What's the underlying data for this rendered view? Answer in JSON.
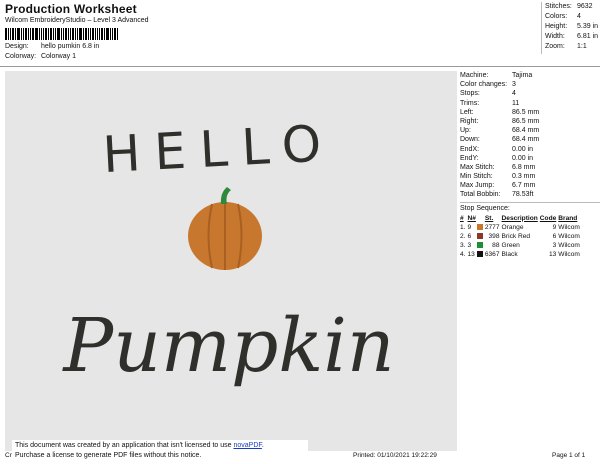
{
  "header": {
    "title": "Production Worksheet",
    "subtitle": "Wilcom EmbroideryStudio – Level 3 Advanced",
    "design_label": "Design:",
    "design_value": "hello pumkin 6.8 in",
    "colorway_label": "Colorway:",
    "colorway_value": "Colorway 1"
  },
  "stats": [
    {
      "label": "Stitches:",
      "value": "9632"
    },
    {
      "label": "Colors:",
      "value": "4"
    },
    {
      "label": "Height:",
      "value": "5.39 in"
    },
    {
      "label": "Width:",
      "value": "6.81 in"
    },
    {
      "label": "Zoom:",
      "value": "1:1"
    }
  ],
  "design": {
    "word_top": "HELLO",
    "word_bottom": "Pumpkin",
    "pumpkin_color": "#c8782e",
    "stem_color": "#2e8a3a",
    "thread_color": "#2f2f2b"
  },
  "machine_info": [
    {
      "label": "Machine:",
      "value": "Tajima"
    },
    {
      "label": "Color changes:",
      "value": "3"
    },
    {
      "label": "Stops:",
      "value": "4"
    },
    {
      "label": "Trims:",
      "value": "11"
    },
    {
      "label": "Left:",
      "value": "86.5 mm"
    },
    {
      "label": "Right:",
      "value": "86.5 mm"
    },
    {
      "label": "Up:",
      "value": "68.4 mm"
    },
    {
      "label": "Down:",
      "value": "68.4 mm"
    },
    {
      "label": "EndX:",
      "value": "0.00 in"
    },
    {
      "label": "EndY:",
      "value": "0.00 in"
    },
    {
      "label": "Max Stitch:",
      "value": "6.8 mm"
    },
    {
      "label": "Min Stitch:",
      "value": "0.3 mm"
    },
    {
      "label": "Max Jump:",
      "value": "6.7 mm"
    },
    {
      "label": "Total Bobbin:",
      "value": "78.53ft"
    }
  ],
  "stop_sequence": {
    "title": "Stop Sequence:",
    "columns": [
      "#",
      "N#",
      "St.",
      "Description",
      "Code",
      "Brand"
    ],
    "rows": [
      {
        "num": "1.",
        "n": "9",
        "color": "#c8782e",
        "st": "2777",
        "desc": "Orange",
        "code": "9",
        "brand": "Wilcom"
      },
      {
        "num": "2.",
        "n": "6",
        "color": "#8a3a22",
        "st": "398",
        "desc": "Brick Red",
        "code": "6",
        "brand": "Wilcom"
      },
      {
        "num": "3.",
        "n": "3",
        "color": "#1f8f34",
        "st": "88",
        "desc": "Green",
        "code": "3",
        "brand": "Wilcom"
      },
      {
        "num": "4.",
        "n": "13",
        "color": "#111111",
        "st": "6367",
        "desc": "Black",
        "code": "13",
        "brand": "Wilcom"
      }
    ]
  },
  "footer": {
    "left": "Cr",
    "printed": "Printed: 01/10/2021 19:22:29",
    "page": "Page 1 of 1"
  },
  "notice": {
    "line1_pre": "This document was created by an application that isn't licensed to use ",
    "link": "novaPDF",
    "line1_post": ".",
    "line2": "Purchase a license to generate PDF files without this notice."
  }
}
